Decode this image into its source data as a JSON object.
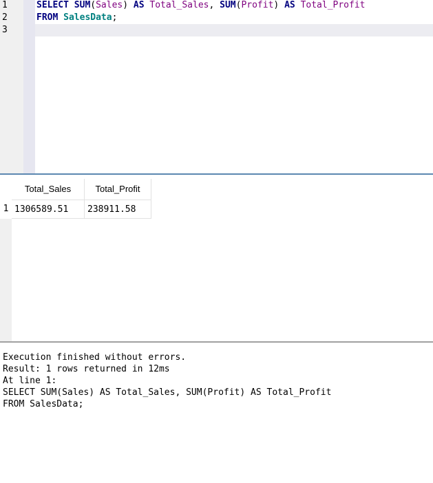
{
  "editor": {
    "line_numbers": [
      "1",
      "2",
      "3"
    ],
    "line1": {
      "select": "SELECT",
      "sum1": "SUM",
      "open1": "(",
      "sales": "Sales",
      "close1": ")",
      "as1": "AS",
      "total_sales": "Total_Sales",
      "comma": ",",
      "sum2": "SUM",
      "open2": "(",
      "profit": "Profit",
      "close2": ")",
      "as2": "AS",
      "total_profit": "Total_Profit"
    },
    "line2": {
      "from": "FROM",
      "table": "SalesData",
      "semicolon": ";"
    }
  },
  "results": {
    "columns": [
      "Total_Sales",
      "Total_Profit"
    ],
    "rows": [
      {
        "num": "1",
        "cells": [
          "1306589.51",
          "238911.58"
        ]
      }
    ]
  },
  "messages": [
    "Execution finished without errors.",
    "Result: 1 rows returned in 12ms",
    "At line 1:",
    "SELECT SUM(Sales) AS Total_Sales, SUM(Profit) AS Total_Profit",
    "FROM SalesData;"
  ],
  "colors": {
    "keyword": "#00007f",
    "identifier": "#7f007f",
    "table": "#008080",
    "splitter": "#5b87b0"
  }
}
